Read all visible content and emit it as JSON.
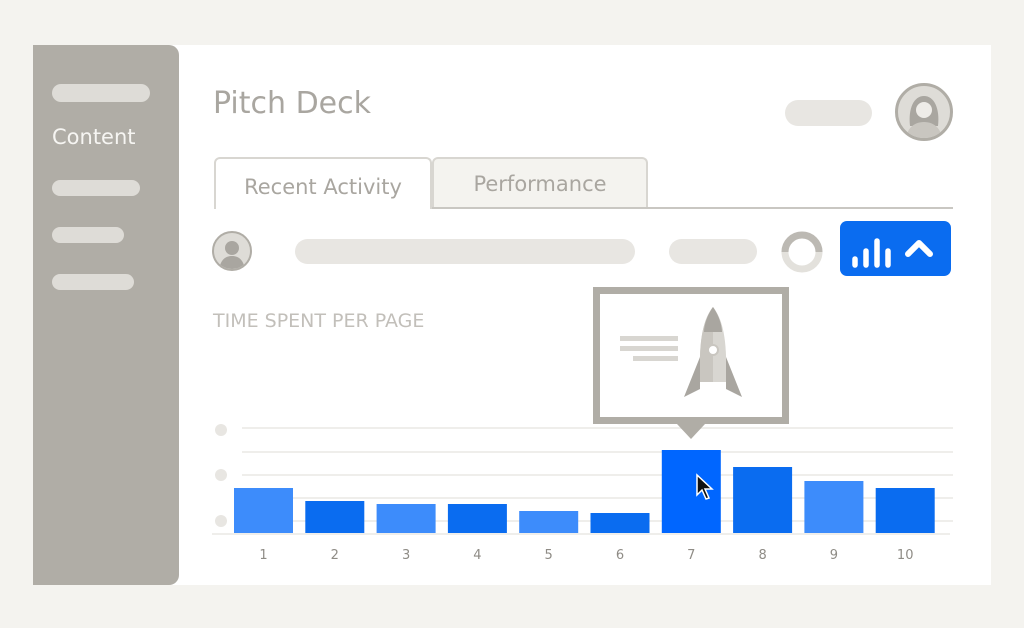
{
  "sidebar": {
    "active_label": "Content"
  },
  "header": {
    "title": "Pitch Deck"
  },
  "tabs": [
    {
      "label": "Recent Activity",
      "active": true
    },
    {
      "label": "Performance",
      "active": false
    }
  ],
  "toolbar": {
    "chart_toggle_icon": "bar-chart-icon",
    "collapse_icon": "chevron-up-icon",
    "accent": "#0a6cf0"
  },
  "chart_data": {
    "type": "bar",
    "title": "TIME SPENT PER PAGE",
    "categories": [
      "1",
      "2",
      "3",
      "4",
      "5",
      "6",
      "7",
      "8",
      "9",
      "10"
    ],
    "values": [
      45,
      32,
      29,
      29,
      22,
      20,
      83,
      66,
      52,
      45
    ],
    "highlighted": "7",
    "grid": true,
    "colors": [
      "#3d8cfb",
      "#0a6cf0",
      "#3d8cfb",
      "#0a6cf0",
      "#3d8cfb",
      "#0a6cf0",
      "#0066ff",
      "#0a6cf0",
      "#3d8cfb",
      "#0a6cf0"
    ]
  },
  "tooltip": {
    "icon": "rocket-icon"
  }
}
